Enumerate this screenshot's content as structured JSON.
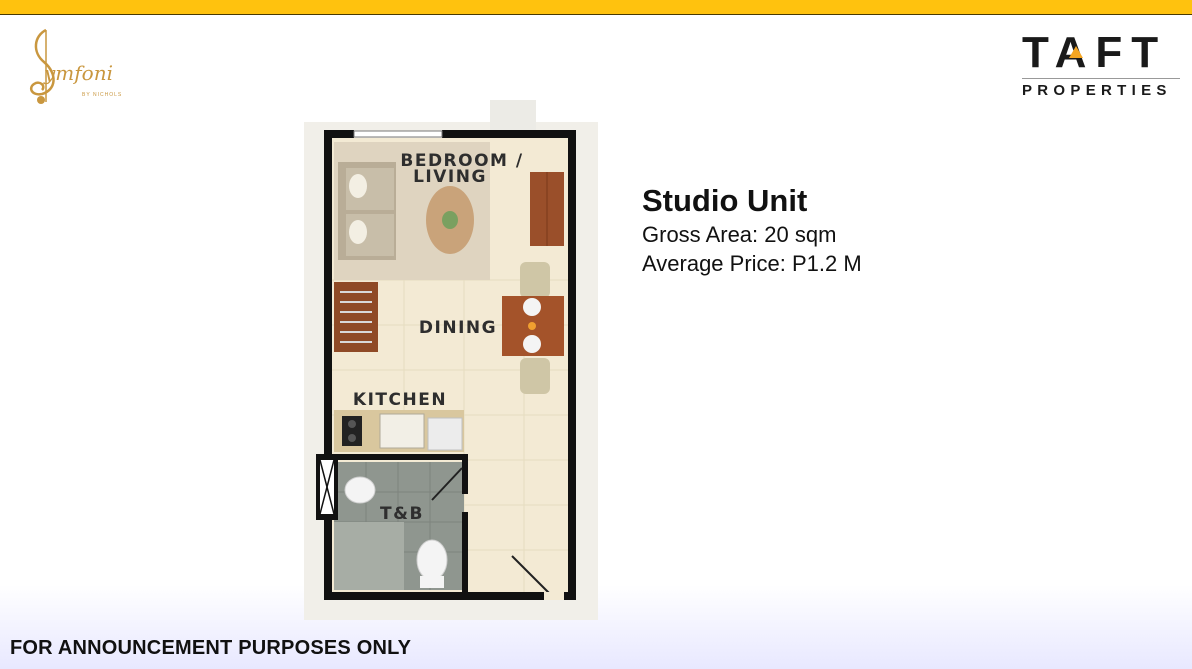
{
  "header": {
    "accent_color": "#ffc20e"
  },
  "logos": {
    "left": {
      "text": "Symfoni",
      "sub": "BY NICHOLS",
      "color": "#c9973f"
    },
    "right": {
      "title": "TAFT",
      "subtitle": "PROPERTIES",
      "accent": "#f5a623"
    }
  },
  "unit": {
    "title": "Studio Unit",
    "gross_area": "Gross Area: 20 sqm",
    "price": "Average Price: P1.2 M"
  },
  "floorplan": {
    "rooms": {
      "bedroom_line1": "BEDROOM /",
      "bedroom_line2": "LIVING",
      "dining": "DINING",
      "kitchen": "KITCHEN",
      "tb": "T&B"
    }
  },
  "footer": {
    "text": "FOR ANNOUNCEMENT PURPOSES ONLY"
  }
}
